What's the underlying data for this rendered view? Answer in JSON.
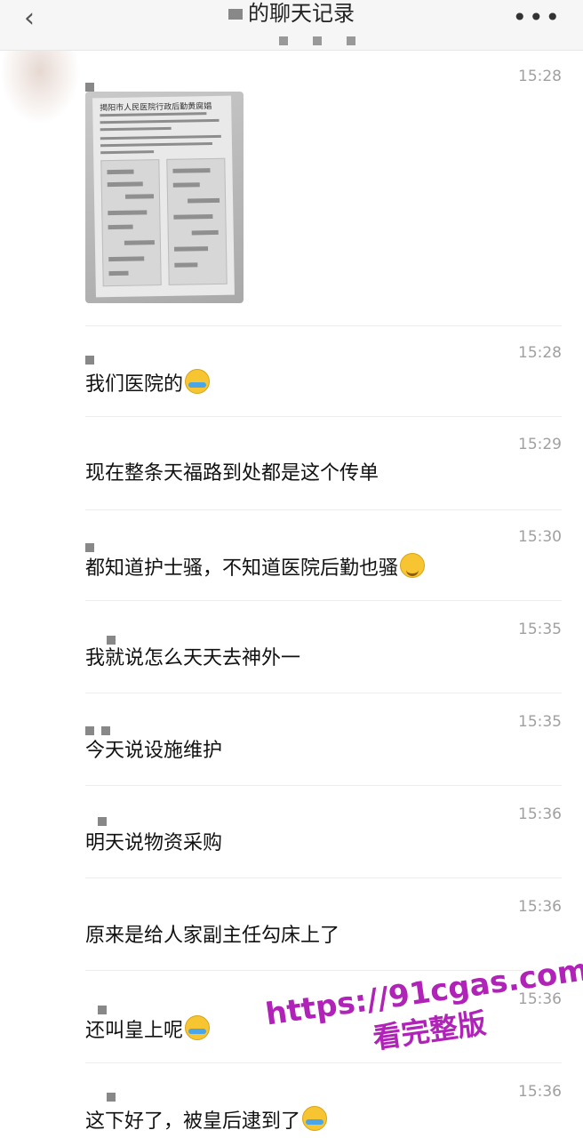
{
  "header": {
    "title": "的聊天记录",
    "back_icon": "chevron-left-icon",
    "more_icon": "more-dots-icon",
    "more_label": "•••"
  },
  "messages": [
    {
      "time": "15:28",
      "type": "image",
      "image": {
        "heading": "揭阳市人民医院行政后勤黄腐娼"
      }
    },
    {
      "time": "15:28",
      "text": "我们医院的",
      "emoji": "cry"
    },
    {
      "time": "15:29",
      "text": "现在整条天福路到处都是这个传单",
      "emoji": ""
    },
    {
      "time": "15:30",
      "text": "都知道护士骚，不知道医院后勤也骚",
      "emoji": "think"
    },
    {
      "time": "15:35",
      "text": "我就说怎么天天去神外一",
      "emoji": ""
    },
    {
      "time": "15:35",
      "text": "今天说设施维护",
      "emoji": ""
    },
    {
      "time": "15:36",
      "text": "明天说物资采购",
      "emoji": ""
    },
    {
      "time": "15:36",
      "text": "原来是给人家副主任勾床上了",
      "emoji": ""
    },
    {
      "time": "15:36",
      "text": "还叫皇上呢",
      "emoji": "cry"
    },
    {
      "time": "15:36",
      "text": "这下好了，被皇后逮到了",
      "emoji": "cry"
    }
  ],
  "watermark": {
    "url": "https://91cgas.com",
    "subtitle": "看完整版"
  }
}
